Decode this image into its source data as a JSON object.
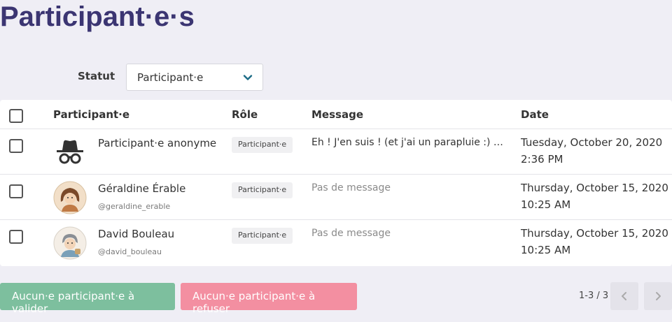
{
  "page": {
    "title": "Participant·e·s"
  },
  "filter": {
    "label": "Statut",
    "selected": "Participant·e"
  },
  "table": {
    "headers": {
      "participant": "Participant·e",
      "role": "Rôle",
      "message": "Message",
      "date": "Date"
    },
    "rows": [
      {
        "name": "Participant·e anonyme",
        "username": "",
        "role": "Participant·e",
        "message": "Eh ! J'en suis ! (et j'ai un parapluie :) )...",
        "date_line1": "Tuesday, October 20, 2020",
        "date_line2": "2:36 PM",
        "avatar_icon": "incognito-icon"
      },
      {
        "name": "Géraldine Érable",
        "username": "@geraldine_erable",
        "role": "Participant·e",
        "message": "Pas de message",
        "date_line1": "Thursday, October 15, 2020",
        "date_line2": "10:25 AM",
        "avatar_icon": "user-avatar"
      },
      {
        "name": "David Bouleau",
        "username": "@david_bouleau",
        "role": "Participant·e",
        "message": "Pas de message",
        "date_line1": "Thursday, October 15, 2020",
        "date_line2": "10:25 AM",
        "avatar_icon": "user-avatar"
      }
    ]
  },
  "actions": {
    "validate_label": "Aucun·e participant·e à valider",
    "refuse_label": "Aucun·e participant·e à refuser"
  },
  "pagination": {
    "info": "1-3 / 3"
  },
  "colors": {
    "title": "#3b3572",
    "validate": "#7dbf9e",
    "refuse": "#f38fa1",
    "chevron": "#1c6b86"
  }
}
